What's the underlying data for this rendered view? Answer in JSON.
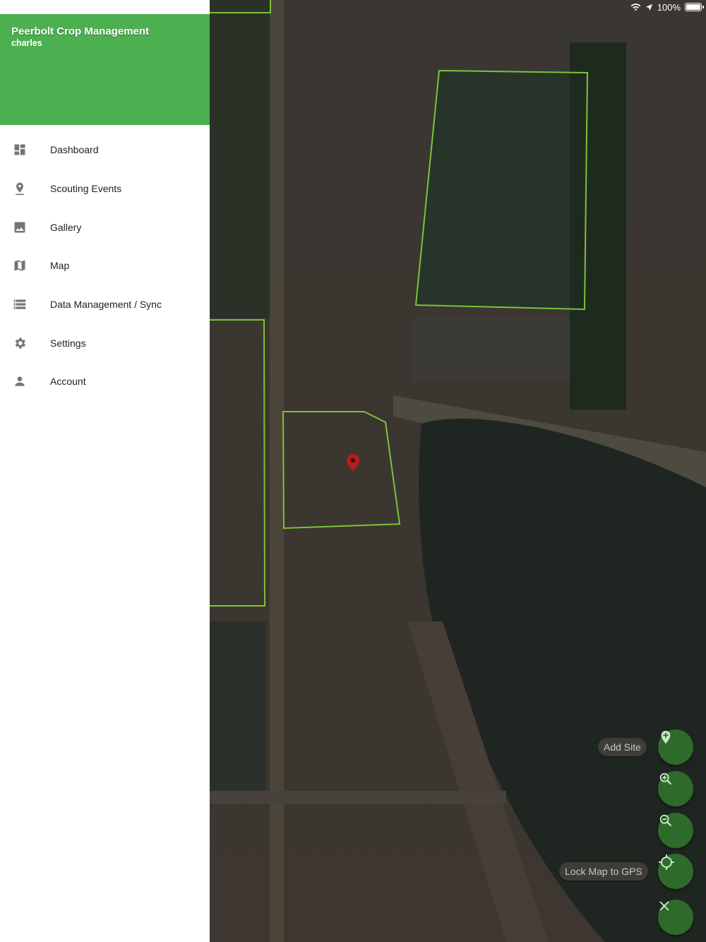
{
  "status_bar": {
    "battery": "100%"
  },
  "drawer": {
    "title": "Peerbolt Crop Management",
    "user": "charles",
    "items": [
      {
        "label": "Dashboard",
        "icon": "dashboard-icon"
      },
      {
        "label": "Scouting Events",
        "icon": "location-pin-icon"
      },
      {
        "label": "Gallery",
        "icon": "image-icon"
      },
      {
        "label": "Map",
        "icon": "map-icon"
      },
      {
        "label": "Data Management / Sync",
        "icon": "storage-icon"
      },
      {
        "label": "Settings",
        "icon": "gear-icon"
      },
      {
        "label": "Account",
        "icon": "person-icon"
      }
    ]
  },
  "map": {
    "add_site_label": "Add Site",
    "lock_gps_label": "Lock Map to GPS",
    "buttons": [
      "add-site-icon",
      "zoom-in-icon",
      "zoom-out-icon",
      "gps-crosshair-icon",
      "close-icon"
    ]
  },
  "colors": {
    "header_green": "#4caf50",
    "fab_green": "#2e6b2a",
    "field_outline": "#7cc23a",
    "marker_red": "#c62828"
  }
}
